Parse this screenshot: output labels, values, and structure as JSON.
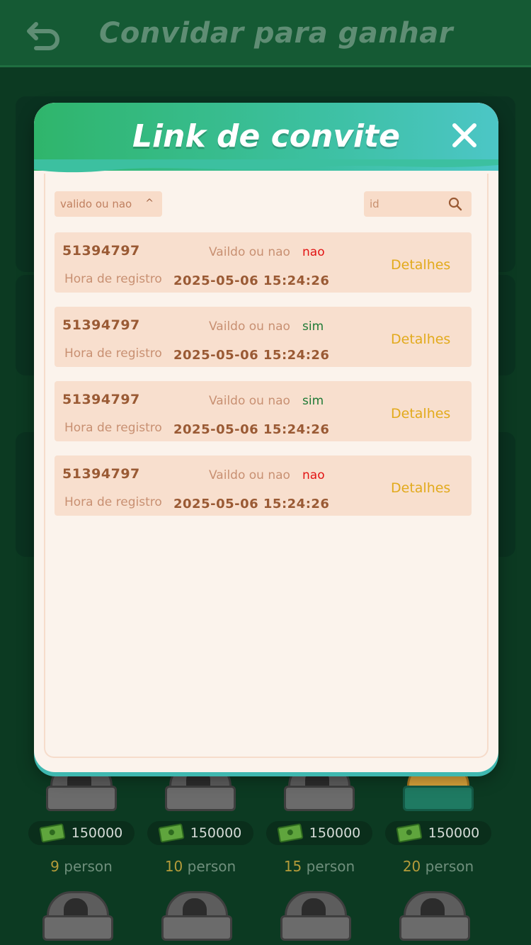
{
  "page": {
    "title": "Convidar para ganhar"
  },
  "rewards": [
    {
      "amount": "150000",
      "count": "9",
      "unit": "person"
    },
    {
      "amount": "150000",
      "count": "10",
      "unit": "person"
    },
    {
      "amount": "150000",
      "count": "15",
      "unit": "person"
    },
    {
      "amount": "150000",
      "count": "20",
      "unit": "person"
    }
  ],
  "modal": {
    "title": "Link de convite",
    "filter": {
      "label": "valido ou nao",
      "caret": "^"
    },
    "search": {
      "placeholder": "id"
    },
    "rows": [
      {
        "id": "51394797",
        "valid_label": "Vaildo ou nao",
        "valid_value": "nao",
        "time_label": "Hora de registro",
        "time_value": "2025-05-06 15:24:26",
        "details_label": "Detalhes"
      },
      {
        "id": "51394797",
        "valid_label": "Vaildo ou nao",
        "valid_value": "sim",
        "time_label": "Hora de registro",
        "time_value": "2025-05-06 15:24:26",
        "details_label": "Detalhes"
      },
      {
        "id": "51394797",
        "valid_label": "Vaildo ou nao",
        "valid_value": "sim",
        "time_label": "Hora de registro",
        "time_value": "2025-05-06 15:24:26",
        "details_label": "Detalhes"
      },
      {
        "id": "51394797",
        "valid_label": "Vaildo ou nao",
        "valid_value": "nao",
        "time_label": "Hora de registro",
        "time_value": "2025-05-06 15:24:26",
        "details_label": "Detalhes"
      }
    ]
  },
  "colors": {
    "valid_no": "#e21414",
    "valid_yes": "#1f7a36",
    "details": "#e2aa1c",
    "header_green": "#2fb56b",
    "header_teal": "#4cc6c6"
  },
  "icons": {
    "back": "back-arrow-icon",
    "close": "close-icon",
    "search": "search-icon",
    "cash": "cash-icon",
    "chest": "chest-icon"
  }
}
